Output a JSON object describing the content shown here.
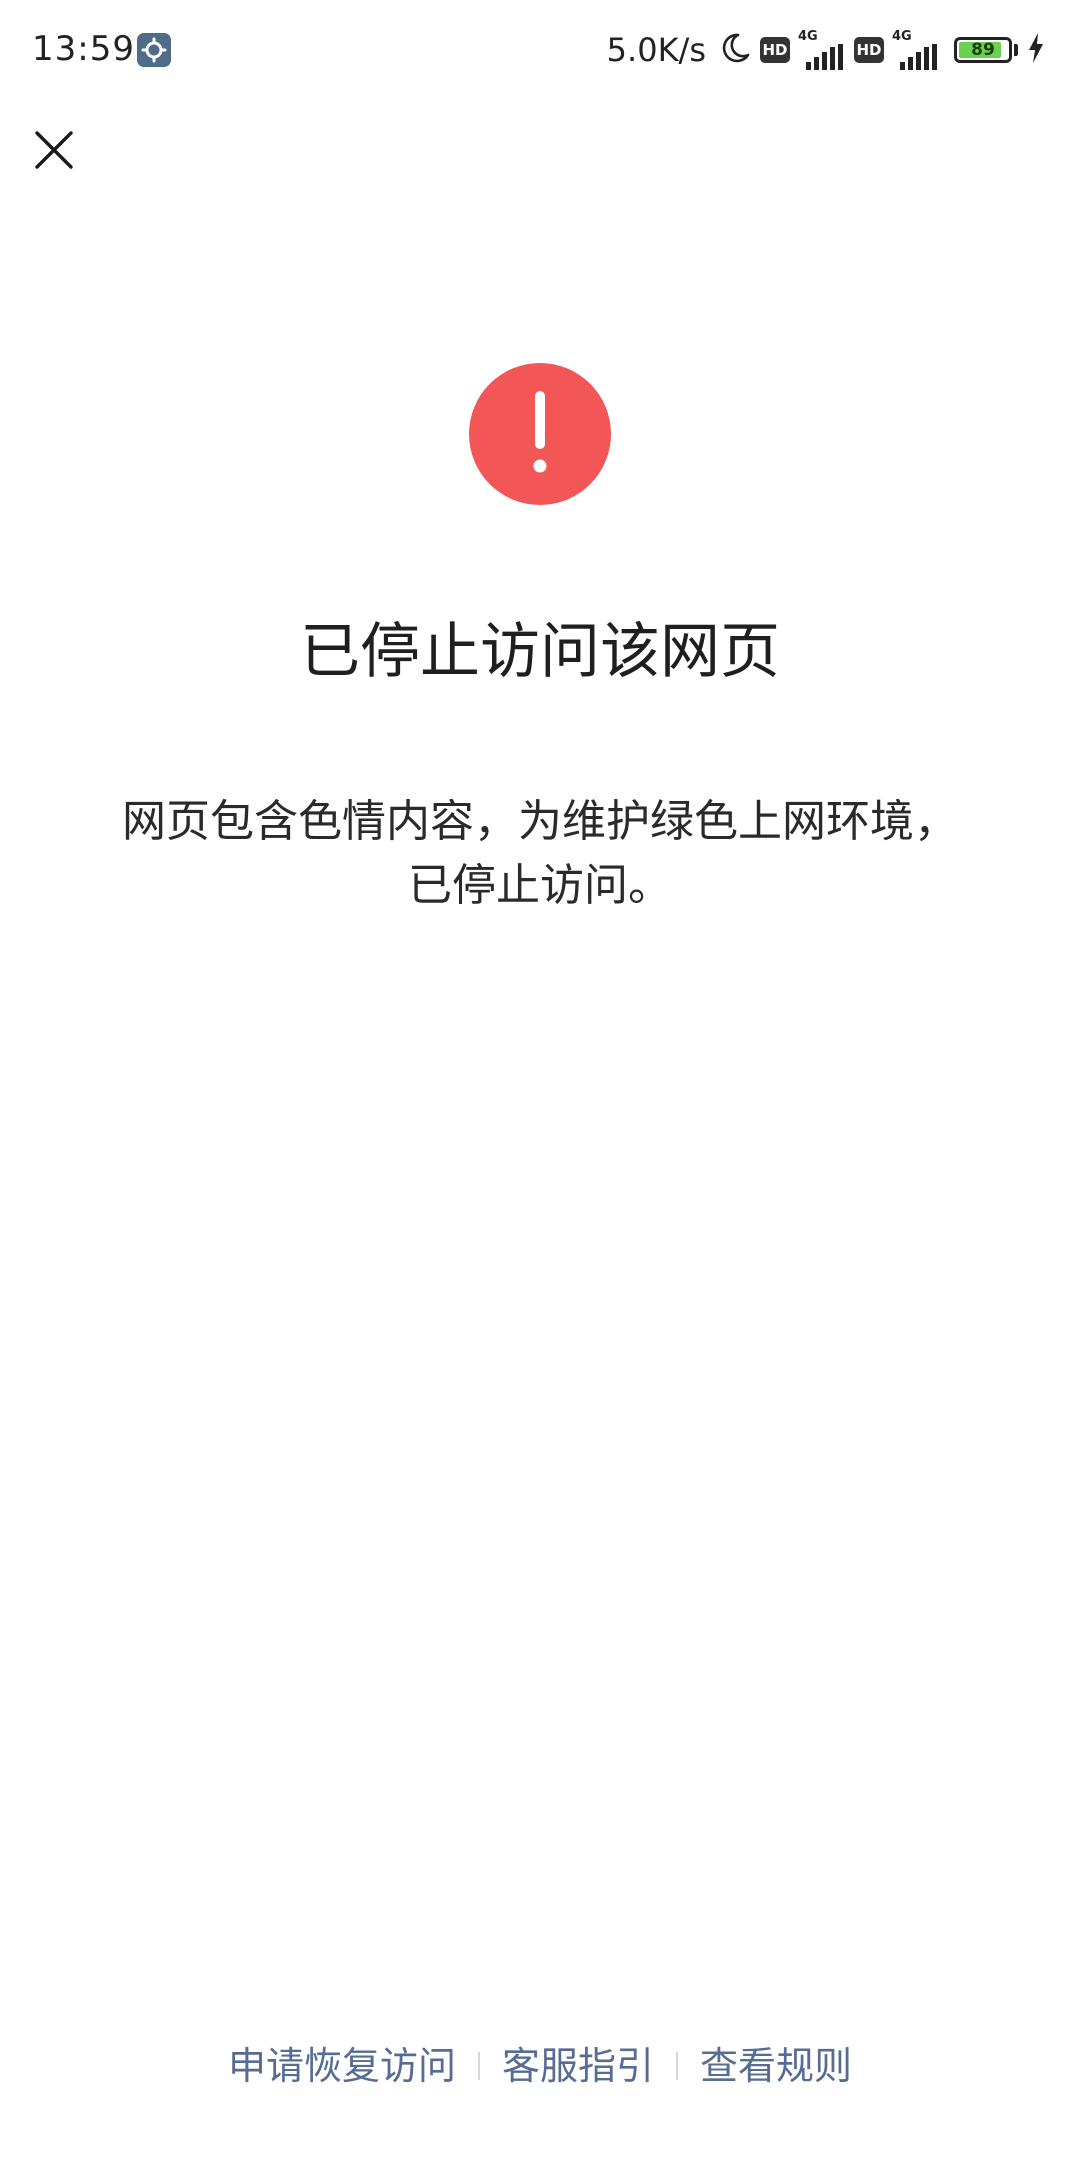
{
  "status_bar": {
    "time": "13:59",
    "settings_icon": "gear-icon",
    "network_speed": "5.0K/s",
    "dnd_icon": "moon-icon",
    "sim1": {
      "hd_label": "HD",
      "network_type": "4G"
    },
    "sim2": {
      "hd_label": "HD",
      "network_type": "4G"
    },
    "battery_level": "89",
    "charging_icon": "lightning-icon",
    "battery_color": "#6ad150"
  },
  "nav": {
    "close_icon": "close-icon"
  },
  "warning": {
    "icon": "exclamation-icon",
    "color": "#f35656"
  },
  "main": {
    "title": "已停止访问该网页",
    "description_line1": "网页包含色情内容，为维护绿色上网环境，",
    "description_line2": "已停止访问。"
  },
  "footer": {
    "link_color": "#576b95",
    "links": [
      {
        "label": "申请恢复访问"
      },
      {
        "label": "客服指引"
      },
      {
        "label": "查看规则"
      }
    ]
  }
}
